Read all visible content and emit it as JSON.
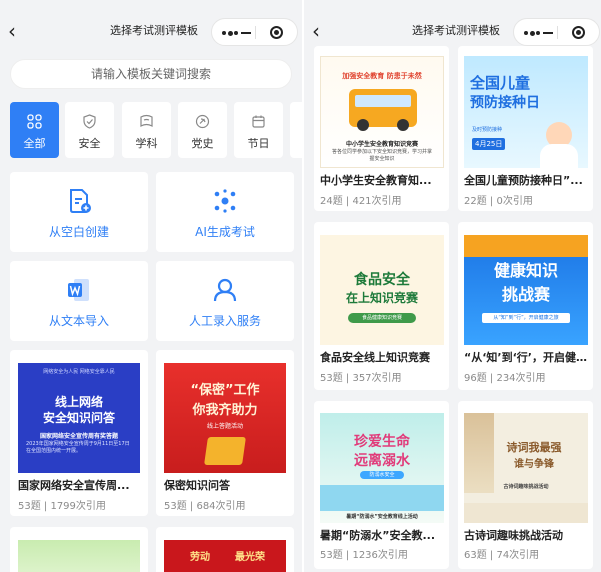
{
  "left": {
    "nav": {
      "back": "‹",
      "title": "选择考试测评模板"
    },
    "search": {
      "placeholder": "请输入模板关键词搜索"
    },
    "categories": [
      {
        "label": "全部",
        "icon": "grid-icon",
        "active": true
      },
      {
        "label": "安全",
        "icon": "shield-icon",
        "active": false
      },
      {
        "label": "学科",
        "icon": "subject-icon",
        "active": false
      },
      {
        "label": "党史",
        "icon": "party-icon",
        "active": false
      },
      {
        "label": "节日",
        "icon": "calendar-icon",
        "active": false
      }
    ],
    "actions": [
      {
        "label": "从空白创建",
        "icon": "document-add-icon"
      },
      {
        "label": "AI生成考试",
        "icon": "ai-dots-icon"
      },
      {
        "label": "从文本导入",
        "icon": "word-icon"
      },
      {
        "label": "人工录入服务",
        "icon": "person-icon"
      }
    ],
    "cards": [
      {
        "title": "国家网络安全宣传周...",
        "meta": "53题 | 1799次引用",
        "thumb": {
          "top": "网络安全为人民  网络安全靠人民",
          "line1": "线上网络",
          "line2": "安全知识问答",
          "sub": "国家网络安全宣传周有奖答题",
          "body": "2023年国家网络安全宣传周于9月11日至17日在全国范围内统一开展。"
        }
      },
      {
        "title": "保密知识问答",
        "meta": "53题 | 684次引用",
        "thumb": {
          "line1": "“保密”工作",
          "line2": "你我齐助力",
          "sub": "线上答题活动"
        }
      },
      {
        "thumb": {
          "line1": ""
        }
      },
      {
        "thumb": {
          "line1": "劳动",
          "line2": "最光荣"
        }
      }
    ]
  },
  "right": {
    "nav": {
      "back": "‹",
      "title": "选择考试测评模板"
    },
    "cards": [
      {
        "title": "中小学生安全教育知...",
        "meta": "24题 | 421次引用",
        "thumb": {
          "line1": "加强安全教育 防患于未然",
          "line2": "中小学生安全教育知识竞赛",
          "sub": "答各位同学参加以下安全知识竞赛，学习并掌握安全知识"
        }
      },
      {
        "title": "全国儿童预防接种日”...",
        "meta": "22题 | 0次引用",
        "thumb": {
          "line1": "全国儿童",
          "line2": "预防接种日",
          "sub": "及时预防接种",
          "date": "4月25日"
        }
      },
      {
        "title": "食品安全线上知识竞赛",
        "meta": "53题 | 357次引用",
        "thumb": {
          "line1": "食品安全",
          "line2": "在上知识竞赛",
          "sub": "食品健康知识竞赛"
        }
      },
      {
        "title": "“从‘知’到‘行’，开启健...",
        "meta": "96题 | 234次引用",
        "thumb": {
          "line1": "健康知识",
          "line2": "挑战赛",
          "sub": "从“知”到“行”，开启健康之旅"
        }
      },
      {
        "title": "暑期“防溺水”安全教...",
        "meta": "53题 | 1236次引用",
        "thumb": {
          "line1": "珍爱生命",
          "line2": "远离溺水",
          "sub": "防溺水安全",
          "body": "暑期“防溺水”安全教育线上活动"
        }
      },
      {
        "title": "古诗词趣味挑战活动",
        "meta": "63题 | 74次引用",
        "thumb": {
          "line1": "诗词我最强",
          "line2": "谁与争锋",
          "sub": "古诗词趣味挑战活动"
        }
      }
    ]
  },
  "colors": {
    "accent": "#2f7ff5",
    "background": "#f2f3f5",
    "card": "#ffffff"
  }
}
